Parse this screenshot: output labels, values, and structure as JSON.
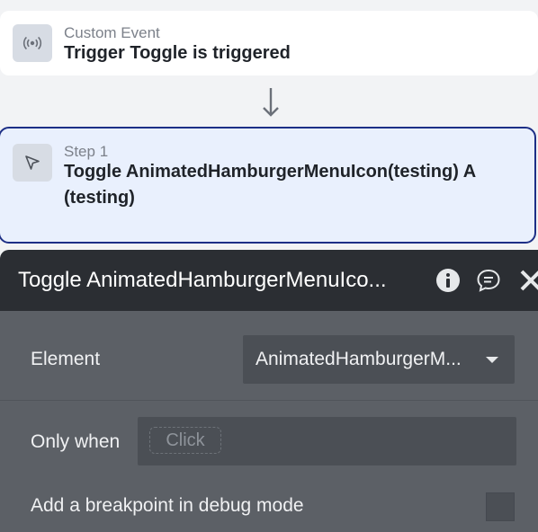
{
  "event": {
    "type_label": "Custom Event",
    "title": "Trigger Toggle is triggered",
    "icon": "broadcast-icon"
  },
  "step": {
    "label": "Step 1",
    "title": "Toggle AnimatedHamburgerMenuIcon(testing) A (testing)",
    "icon": "cursor-arrow-icon"
  },
  "panel": {
    "title": "Toggle AnimatedHamburgerMenuIco...",
    "icons": [
      "info-icon",
      "comment-icon",
      "close-icon"
    ],
    "element_label": "Element",
    "element_value": "AnimatedHamburgerM...",
    "only_when_label": "Only when",
    "only_when_placeholder": "Click",
    "breakpoint_label": "Add a breakpoint in debug mode",
    "breakpoint_checked": false
  },
  "colors": {
    "step_border": "#1d2f86",
    "step_bg": "#e9f0fd",
    "panel_header": "#2b2e33",
    "panel_body": "#5c6066"
  }
}
